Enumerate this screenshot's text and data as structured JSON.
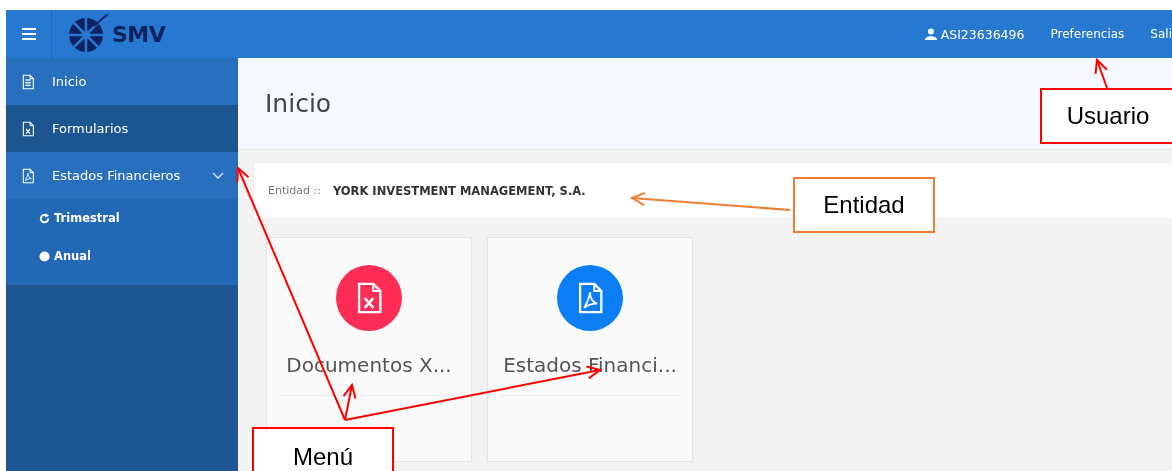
{
  "header": {
    "logo_text": "SMV",
    "user": "ASI23636496",
    "links": [
      "Preferencias",
      "Sali"
    ]
  },
  "sidebar": {
    "items": [
      {
        "label": "Inicio",
        "kind": "clipboard",
        "selected": false
      },
      {
        "label": "Formularios",
        "kind": "excel",
        "selected": true
      },
      {
        "label": "Estados Financieros",
        "kind": "pdf",
        "selected": false,
        "expanded": true,
        "children": [
          {
            "label": "Trimestral",
            "kind": "refresh"
          },
          {
            "label": "Anual",
            "kind": "circle"
          }
        ]
      }
    ]
  },
  "page": {
    "title": "Inicio",
    "entity_label": "Entidad ::",
    "entity_name": "YORK INVESTMENT MANAGEMENT, S.A."
  },
  "tiles": [
    {
      "label": "Documentos X...",
      "kind": "excel",
      "color": "#fe2d55"
    },
    {
      "label": "Estados Financi...",
      "kind": "pdf",
      "color": "#0b7ef5"
    }
  ],
  "annotations": [
    {
      "label": "Usuario",
      "color": "#ff0000"
    },
    {
      "label": "Entidad",
      "color": "#ed7d31"
    },
    {
      "label": "Menú",
      "color": "#ff0000"
    }
  ]
}
